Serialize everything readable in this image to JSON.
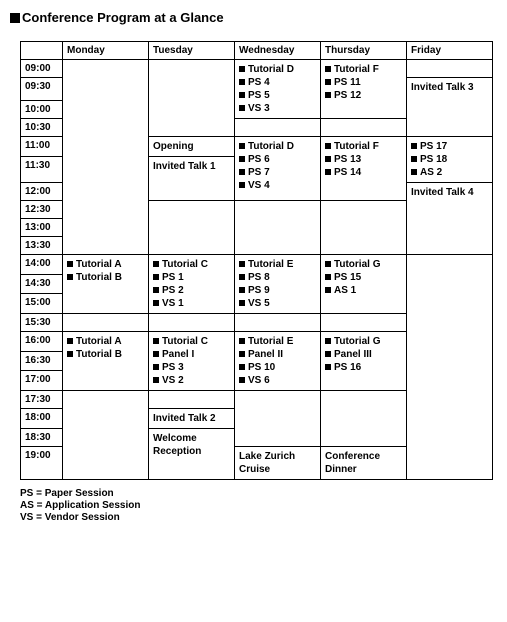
{
  "title": "Conference Program at a Glance",
  "days": {
    "d0": "",
    "d1": "Monday",
    "d2": "Tuesday",
    "d3": "Wednesday",
    "d4": "Thursday",
    "d5": "Friday"
  },
  "times": {
    "t0900": "09:00",
    "t0930": "09:30",
    "t1000": "10:00",
    "t1030": "10:30",
    "t1100": "11:00",
    "t1130": "11:30",
    "t1200": "12:00",
    "t1230": "12:30",
    "t1300": "13:00",
    "t1330": "13:30",
    "t1400": "14:00",
    "t1430": "14:30",
    "t1500": "15:00",
    "t1530": "15:30",
    "t1600": "16:00",
    "t1630": "16:30",
    "t1700": "17:00",
    "t1730": "17:30",
    "t1800": "18:00",
    "t1830": "18:30",
    "t1900": "19:00"
  },
  "cells": {
    "wed_0900": [
      "Tutorial D",
      "PS 4",
      "PS 5",
      "VS 3"
    ],
    "thu_0900": [
      "Tutorial F",
      "PS 11",
      "PS 12"
    ],
    "fri_0930": "Invited Talk 3",
    "tue_1100": "Opening",
    "wed_1100": [
      "Tutorial D",
      "PS 6",
      "PS 7",
      "VS 4"
    ],
    "thu_1100": [
      "Tutorial F",
      "PS 13",
      "PS 14"
    ],
    "fri_1100": [
      "PS 17",
      "PS 18",
      "AS 2"
    ],
    "tue_1130": "Invited Talk 1",
    "fri_1200": "Invited Talk 4",
    "mon_1400": [
      "Tutorial A",
      "Tutorial B"
    ],
    "tue_1400": [
      "Tutorial C",
      "PS 1",
      "PS 2",
      "VS 1"
    ],
    "wed_1400": [
      "Tutorial E",
      "PS 8",
      "PS 9",
      "VS 5"
    ],
    "thu_1400": [
      "Tutorial G",
      "PS 15",
      "AS 1"
    ],
    "mon_1600": [
      "Tutorial A",
      "Tutorial B"
    ],
    "tue_1600": [
      "Tutorial C",
      "Panel I",
      "PS 3",
      "VS 2"
    ],
    "wed_1600": [
      "Tutorial E",
      "Panel II",
      "PS 10",
      "VS 6"
    ],
    "thu_1600": [
      "Tutorial G",
      "Panel III",
      "PS 16"
    ],
    "tue_1800": "Invited Talk 2",
    "tue_1830": "Welcome Reception",
    "wed_1900": "Lake Zurich Cruise",
    "thu_1900": "Conference Dinner"
  },
  "legend": {
    "l1": "PS = Paper Session",
    "l2": "AS = Application Session",
    "l3": "VS = Vendor Session"
  }
}
